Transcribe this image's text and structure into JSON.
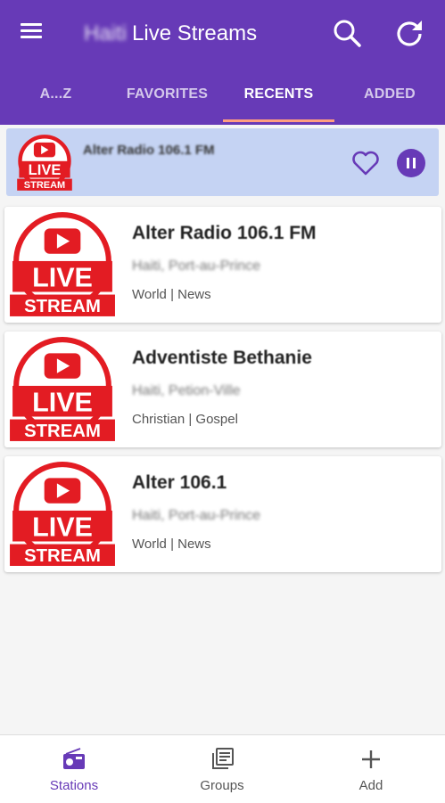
{
  "app_bar": {
    "title_prefix": "Haiti",
    "title": "Live Streams",
    "background_color": "#673ab7"
  },
  "tabs": [
    {
      "label": "A...Z",
      "active": false
    },
    {
      "label": "FAVORITES",
      "active": false
    },
    {
      "label": "RECENTS",
      "active": true
    },
    {
      "label": "ADDED",
      "active": false
    }
  ],
  "now_playing": {
    "station": "Alter Radio 106.1 FM",
    "logo_text": [
      "LIVE",
      "STREAM"
    ],
    "state": "playing"
  },
  "stations": [
    {
      "name": "Alter Radio 106.1 FM",
      "location": "Haiti, Port-au-Prince",
      "genres": "World | News"
    },
    {
      "name": "Adventiste Bethanie",
      "location": "Haiti, Petion-Ville",
      "genres": "Christian | Gospel"
    },
    {
      "name": "Alter 106.1",
      "location": "Haiti, Port-au-Prince",
      "genres": "World | News"
    }
  ],
  "logo": {
    "line1": "LIVE",
    "line2": "STREAM",
    "color": "#e31c23"
  },
  "bottom_nav": [
    {
      "label": "Stations",
      "icon": "radio-icon",
      "active": true
    },
    {
      "label": "Groups",
      "icon": "library-icon",
      "active": false
    },
    {
      "label": "Add",
      "icon": "plus-icon",
      "active": false
    }
  ]
}
